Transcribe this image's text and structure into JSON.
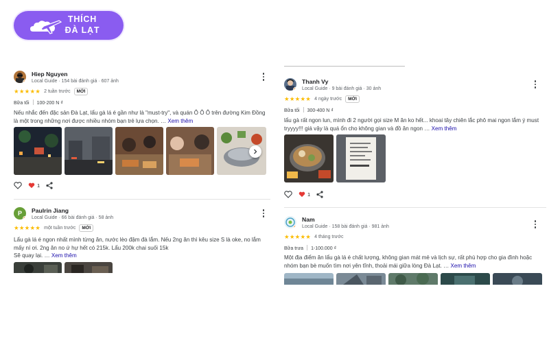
{
  "logo": {
    "line1": "THÍCH",
    "line2": "ĐÀ LẠT"
  },
  "colors": {
    "star": "#fbbc04",
    "link": "#1a0dab",
    "logo_bg": "#8a5cf0",
    "heart": "#e53935"
  },
  "reviews": [
    {
      "name": "Hiep Nguyen",
      "meta": "Local Guide · 154 bài đánh giá · 607 ảnh",
      "stars": "★★★★★",
      "rating": 5,
      "time": "2 tuần trước",
      "badge": "MỚI",
      "meal": "Bữa tối",
      "price": "100-200 N ₫",
      "text": "Nếu nhắc đến đặc sản Đà Lạt, lẩu gà lá é gần như là \"must-try\", và quán Ô Ô Ô trên đường Kim Đồng là một trong những nơi được nhiều nhóm bạn trẻ lựa chọn. …",
      "more": "Xem thêm",
      "reaction_count": "1"
    },
    {
      "name": "Paulrin Jiang",
      "meta": "Local Guide · 66 bài đánh giá · 58 ảnh",
      "stars": "★★★★★",
      "rating": 5,
      "time": "một tuần trước",
      "badge": "MỚI",
      "text": "Lẩu gà lá é ngon nhất mình từng ăn, nước lèo đậm đà lắm. Nếu 2ng ăn thì kêu size S là oke, no lắm mấy ní ơi. 2ng ăn no ứ hự hết có 215k. Lẩu 200k chai suối 15k",
      "text2": "Sẽ quay lại. …",
      "more": "Xem thêm"
    },
    {
      "name": "Thanh Vy",
      "meta": "Local Guide · 9 bài đánh giá · 30 ảnh",
      "stars": "★★★★★",
      "rating": 5,
      "time": "4 ngày trước",
      "badge": "MỚI",
      "meal": "Bữa tối",
      "price": "300-400 N ₫",
      "text": "lẩu gà rất ngon lun, mình đi 2 người gọi size M ăn ko hết... khoai tây chiên lắc phô mai ngon lắm ý must tryyyy!!! giá vậy là quá ổn cho không gian và đồ ăn ngon …",
      "more": "Xem thêm",
      "reaction_count": "1"
    },
    {
      "name": "Nam",
      "meta": "Local Guide · 158 bài đánh giá · 981 ảnh",
      "stars": "★★★★★",
      "rating": 5,
      "time": "4 tháng trước",
      "meal": "Bữa trưa",
      "price": "1-100.000 ₫",
      "text": "Một địa điểm ăn lẩu gà lá é chất lượng, không gian mát mẻ và lịch sự, rất phù hợp cho gia đình hoặc nhóm bạn bè muốn tìm nơi yên tĩnh, thoải mái giữa lòng Đà Lạt. …",
      "more": "Xem thêm"
    }
  ]
}
